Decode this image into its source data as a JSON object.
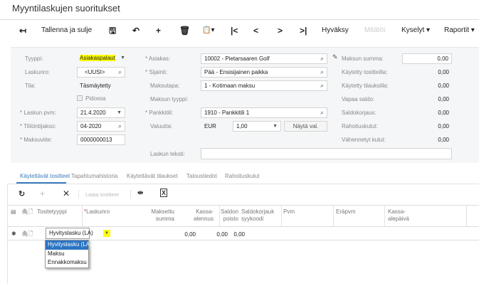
{
  "title": "Myyntilaskujen suoritukset",
  "toolbar": {
    "save_close": "Tallenna ja sulje",
    "approve": "Hyväksy",
    "cancel": "Mitätöi",
    "queries": "Kyselyt",
    "reports": "Raportit"
  },
  "form": {
    "tyyppi_label": "Tyyppi:",
    "tyyppi": "Asiakaspalaut",
    "laskunro_label": "Laskunro:",
    "laskunro": "<UUSI>",
    "tila_label": "Tila:",
    "tila": "Täsmäytetty",
    "pidossa": "Pidossa",
    "laskun_pvm_label": "Laskun pvm:",
    "laskun_pvm": "21.4.2020",
    "tiliointijakso_label": "Tiliöintijakso:",
    "tiliointijakso": "04-2020",
    "maksuviite_label": "Maksuviite:",
    "maksuviite": "0000000013",
    "asiakas_label": "Asiakas:",
    "asiakas": "10002 - Pietarsaaren Golf",
    "sijainti_label": "Sijainti:",
    "sijainti": "Pää - Ensisijainen paikka",
    "maksutapa_label": "Maksutapa:",
    "maksutapa": "1 - Kotimaan maksu",
    "maksun_tyyppi_label": "Maksun tyyppi:",
    "pankkitili_label": "Pankkitili:",
    "pankkitili": "1910 - Pankkitili 1",
    "valuutta_label": "Valuutta:",
    "valuutta": "EUR",
    "kurssi": "1,00",
    "nayta_val": "Näytä val.",
    "laskun_teksti_label": "Laskun teksti:",
    "laskun_teksti": ""
  },
  "summary": [
    {
      "label": "Maksun summa:",
      "value": "0,00"
    },
    {
      "label": "Käytetty tositteilla:",
      "value": "0,00"
    },
    {
      "label": "Käytetty tilauksilla:",
      "value": "0,00"
    },
    {
      "label": "Vapaa saldo:",
      "value": "0,00"
    },
    {
      "label": "Saldokorjaus:",
      "value": "0,00"
    },
    {
      "label": "Rahoituskulut:",
      "value": "0,00"
    },
    {
      "label": "Vähennetyt kulut:",
      "value": "0,00"
    }
  ],
  "tabs": [
    "Käytettävät tositteet",
    "Tapahtumahistoria",
    "Käytettävät tilaukset",
    "Taloustiedot",
    "Rahoituskulut"
  ],
  "grid_toolbar": {
    "load": "Lataa tositteet"
  },
  "columns": {
    "tositetyyppi": "Tositetyyppi",
    "laskunro": "Laskunro",
    "maksettu1": "Maksettu",
    "maksettu2": "summa",
    "kassa1": "Kassa-",
    "kassa2": "alennus",
    "saldon1": "Saldon",
    "saldon2": "poisto",
    "korj1": "Saldokorjauk",
    "korj2": "syykoodi",
    "pvm": "Pvm",
    "erapvm": "Eräpvm",
    "kpv1": "Kassa-",
    "kpv2": "alepäivä"
  },
  "row": {
    "tositetyyppi": "Hyvityslasku (LA)",
    "maksettu": "0,00",
    "kassa": "0,00",
    "saldon": "0,00"
  },
  "dropdown": [
    "Hyvityslasku (LA)",
    "Maksu",
    "Ennakkomaksu"
  ],
  "colors": {
    "highlight": "#ffff00",
    "accent": "#3a7bbf",
    "selected": "#2b74c4"
  }
}
